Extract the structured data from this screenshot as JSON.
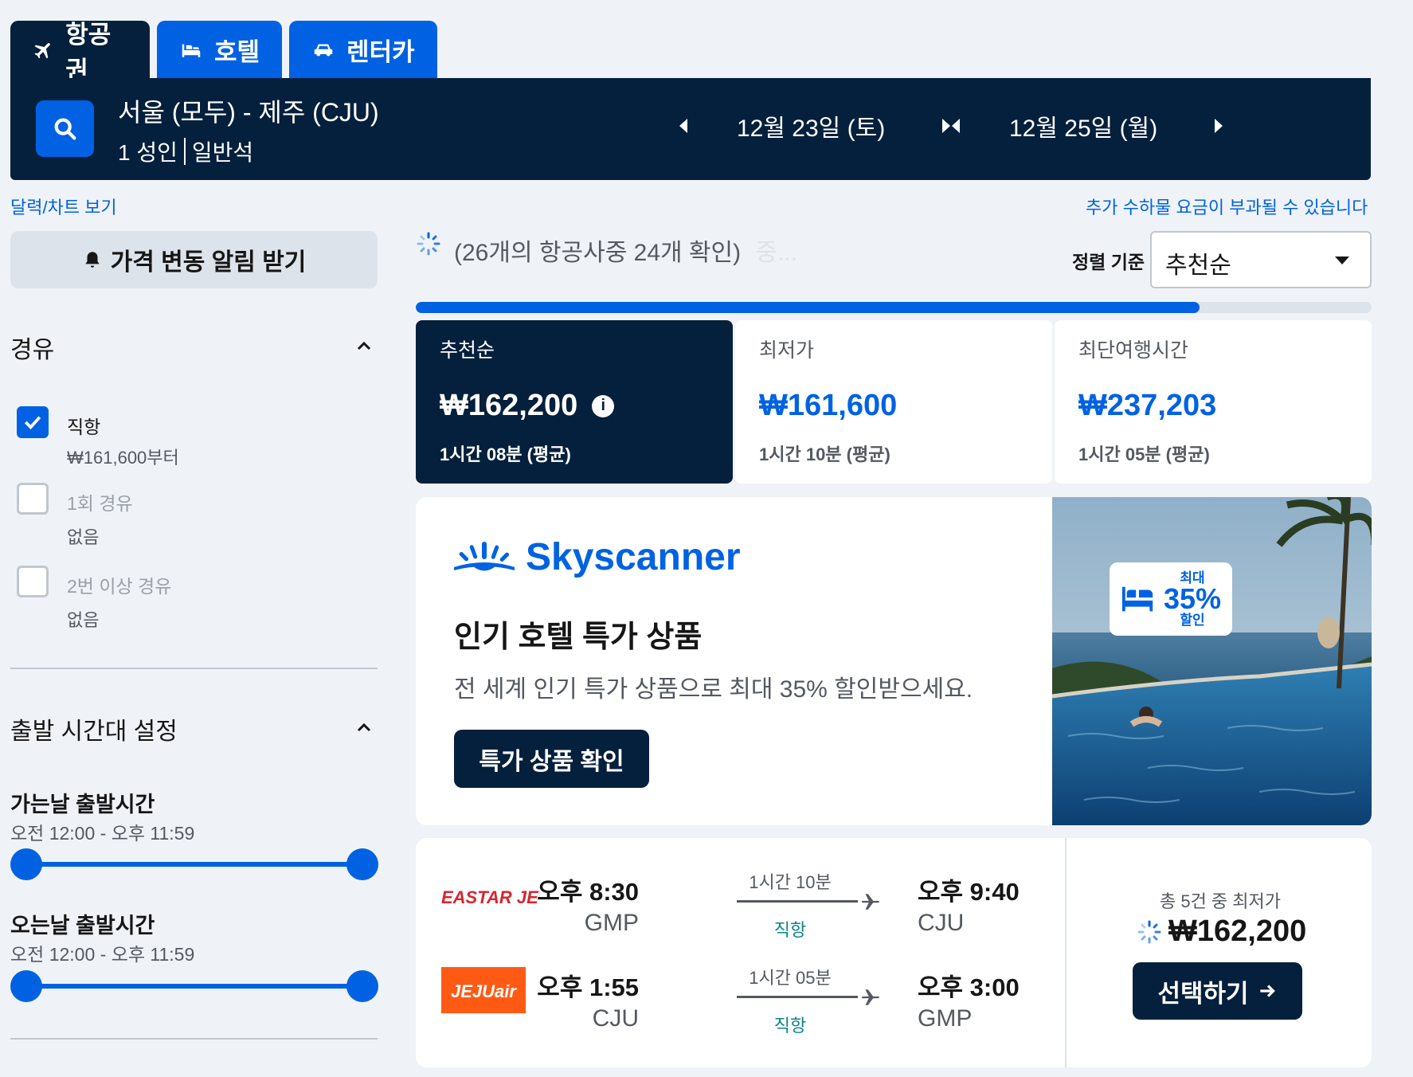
{
  "tabs": [
    {
      "label": "항공권",
      "icon": "plane-icon"
    },
    {
      "label": "호텔",
      "icon": "bed-icon"
    },
    {
      "label": "렌터카",
      "icon": "car-icon"
    }
  ],
  "search": {
    "route": "서울 (모두) - 제주 (CJU)",
    "passengers": "1 성인",
    "cabin": "일반석",
    "depart_date": "12월 23일 (토)",
    "return_date": "12월 25일 (월)"
  },
  "links": {
    "calendar": "달력/차트 보기",
    "baggage_notice": "추가 수하물 요금이 부과될 수 있습니다"
  },
  "sidebar": {
    "price_alert": "가격 변동 알림 받기",
    "stops": {
      "title": "경유",
      "options": [
        {
          "label": "직항",
          "sub": "₩161,600부터",
          "checked": true
        },
        {
          "label": "1회 경유",
          "sub": "없음",
          "checked": false
        },
        {
          "label": "2번 이상 경유",
          "sub": "없음",
          "checked": false
        }
      ]
    },
    "departure_times": {
      "title": "출발 시간대 설정",
      "outbound_label": "가는날 출발시간",
      "outbound_range": "오전 12:00 - 오후 11:59",
      "inbound_label": "오는날 출발시간",
      "inbound_range": "오전 12:00 - 오후 11:59"
    }
  },
  "results_header": {
    "checked_text": "(26개의 항공사중 24개 확인)",
    "checked_suffix": "중...",
    "sort_label": "정렬 기준",
    "sort_value": "추천순",
    "progress": 0.82
  },
  "sort_cards": [
    {
      "label": "추천순",
      "price": "₩162,200",
      "duration": "1시간 08분 (평균)",
      "active": true
    },
    {
      "label": "최저가",
      "price": "₩161,600",
      "duration": "1시간 10분 (평균)",
      "active": false
    },
    {
      "label": "최단여행시간",
      "price": "₩237,203",
      "duration": "1시간 05분 (평균)",
      "active": false
    }
  ],
  "ad": {
    "brand": "Skyscanner",
    "title": "인기 호텔 특가 상품",
    "description": "전 세계 인기 특가 상품으로 최대 35% 할인받으세요.",
    "cta": "특가 상품 확인",
    "badge_top": "최대",
    "badge_pct": "35%",
    "badge_bottom": "할인"
  },
  "result": {
    "legs": [
      {
        "airline": "EASTAR JET",
        "dep_time": "오후 8:30",
        "dep_code": "GMP",
        "duration": "1시간 10분",
        "stops": "직항",
        "arr_time": "오후 9:40",
        "arr_code": "CJU"
      },
      {
        "airline": "JEJUair",
        "dep_time": "오후 1:55",
        "dep_code": "CJU",
        "duration": "1시간 05분",
        "stops": "직항",
        "arr_time": "오후 3:00",
        "arr_code": "GMP"
      }
    ],
    "deals_label": "총 5건 중 최저가",
    "price": "₩162,200",
    "select_label": "선택하기"
  },
  "colors": {
    "brand_blue": "#0062e3",
    "navy": "#05203c",
    "background": "#eff3f8",
    "eastar_red": "#d6262f",
    "jejuair_orange": "#ff5a13",
    "stop_teal": "#0c838a"
  }
}
